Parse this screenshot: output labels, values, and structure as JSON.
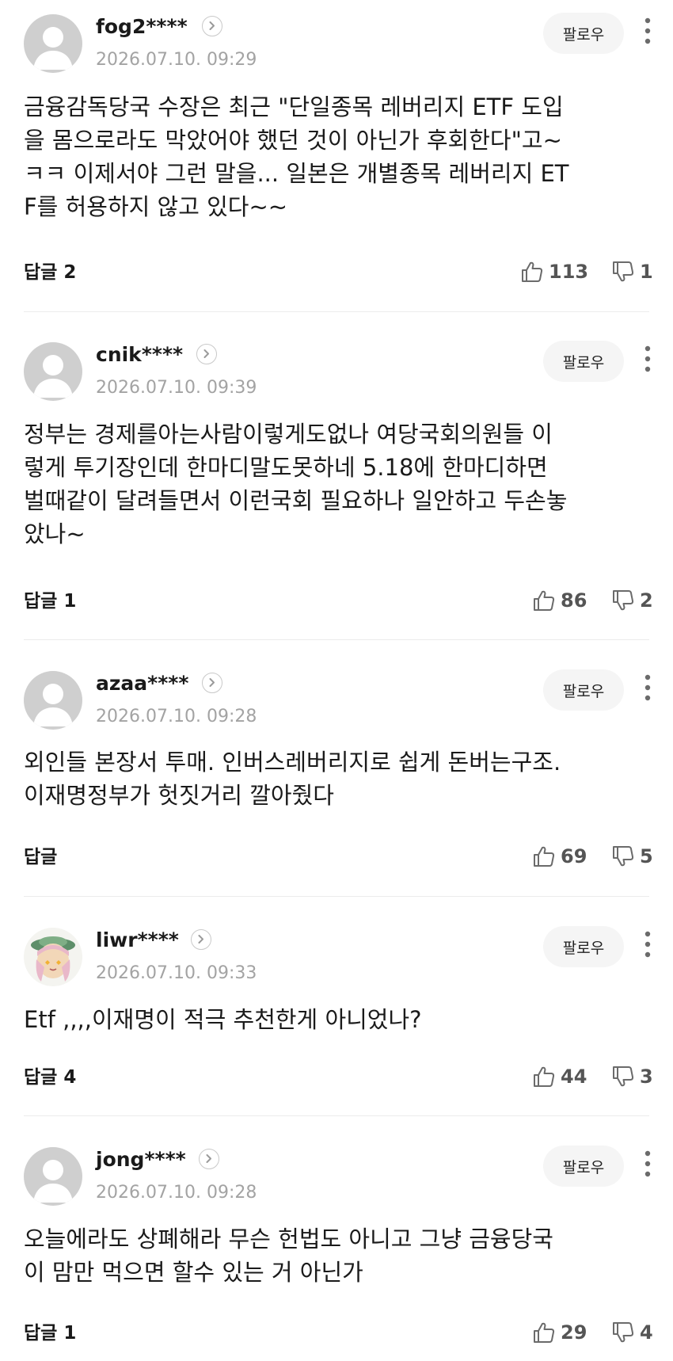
{
  "comments": [
    {
      "username": "fog2****",
      "timestamp": "2026.07.10. 09:29",
      "follow_label": "팔로우",
      "body": "금융감독당국 수장은 최근 \"단일종목 레버리지 ETF 도입\n을 몸으로라도 막았어야 했던 것이 아닌가 후회한다\"고~\nㅋㅋ 이제서야 그런 말을... 일본은 개별종목 레버리지 ET\nF를 허용하지 않고 있다~~",
      "reply_label": "답글 2",
      "likes": "113",
      "dislikes": "1",
      "avatar": "default-avatar"
    },
    {
      "username": "cnik****",
      "timestamp": "2026.07.10. 09:39",
      "follow_label": "팔로우",
      "body": "정부는 경제를아는사람이렇게도없나 여당국회의원들 이\n렇게 투기장인데 한마디말도못하네 5.18에 한마디하면\n벌때같이 달려들면서 이런국회 필요하나 일안하고 두손놓\n았나~",
      "reply_label": "답글 1",
      "likes": "86",
      "dislikes": "2",
      "avatar": "default-avatar"
    },
    {
      "username": "azaa****",
      "timestamp": "2026.07.10. 09:28",
      "follow_label": "팔로우",
      "body": "외인들 본장서 투매. 인버스레버리지로 쉽게 돈버는구조.\n이재명정부가 헛짓거리 깔아줬다",
      "reply_label": "답글",
      "likes": "69",
      "dislikes": "5",
      "avatar": "default-avatar"
    },
    {
      "username": "liwr****",
      "timestamp": "2026.07.10. 09:33",
      "follow_label": "팔로우",
      "body": "Etf ,,,,이재명이 적극 추천한게 아니었나?",
      "reply_label": "답글 4",
      "likes": "44",
      "dislikes": "3",
      "avatar": "character-avatar"
    },
    {
      "username": "jong****",
      "timestamp": "2026.07.10. 09:28",
      "follow_label": "팔로우",
      "body": "오늘에라도 상폐해라 무슨 헌법도 아니고 그냥 금융당국\n이 맘만 먹으면 할수 있는 거 아닌가",
      "reply_label": "답글 1",
      "likes": "29",
      "dislikes": "4",
      "avatar": "default-avatar"
    }
  ],
  "colors": {
    "avatar_bg": "#c9c9c9",
    "text": "#1a1a1a",
    "timestamp": "#a3a3a3",
    "counts": "#555555",
    "follow_bg": "#f5f5f5",
    "divider": "#ececec"
  }
}
